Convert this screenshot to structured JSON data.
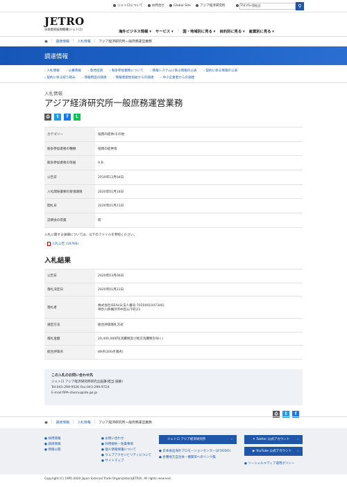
{
  "util": {
    "links": [
      "ジェトロについて",
      "お問合せ",
      "Global Site",
      "アジア経済研究所"
    ],
    "mypage": "マイページ",
    "search_placeholder": "サイト内検索"
  },
  "logo": {
    "main": "JETRO",
    "sub": "日本貿易振興機構(ジェトロ)"
  },
  "mainnav": [
    "海外ビジネス情報",
    "サービス",
    "国・地域別に見る",
    "目的別に見る",
    "産業別に見る"
  ],
  "breadcrumb": [
    "調達情報",
    "入札情報",
    "アジア経済研究所一般庶務運営業務"
  ],
  "banner_title": "調達情報",
  "subnav": [
    "入札情報",
    "公募情報",
    "意見招請",
    "競争参加資格について",
    "情報システムに係る情報の公表",
    "契約に係る情報の公表",
    "契約に係る取り組み",
    "情報物品の調達",
    "情報者能性指紋からの調達",
    "中小企業者からの調達"
  ],
  "pre_title": "入札情報",
  "title": "アジア経済研究所一般庶務運営業務",
  "share_icons": [
    "print-icon",
    "twitter-icon",
    "facebook-icon",
    "line-icon"
  ],
  "table1": [
    {
      "k": "カテゴリー",
      "v": "役務の提供/その他"
    },
    {
      "k": "競争参加資格の種類",
      "v": "役務の提供等"
    },
    {
      "k": "競争参加資格の等級",
      "v": "A,B"
    },
    {
      "k": "公告日",
      "v": "2019年12月04日"
    },
    {
      "k": "入札関係書類の受領期限",
      "v": "2020年01月14日"
    },
    {
      "k": "開札日",
      "v": "2020年01月21日"
    },
    {
      "k": "説明会の有無",
      "v": "有"
    }
  ],
  "note": "入札に関する詳細については、以下のファイルを参照ください。",
  "file_link": "入札公告 (187KB)",
  "section2_title": "入札結果",
  "table2": [
    {
      "k": "公告日",
      "v": "2020年03月06日"
    },
    {
      "k": "落札決定日",
      "v": "2020年01月21日"
    },
    {
      "k": "落札者",
      "v": "株式会社ISEALS(法人番号:7020001047346)",
      "v2": "神奈川県横浜市中区山下町23"
    },
    {
      "k": "選定方法",
      "v": "総合評価落札方式"
    },
    {
      "k": "落札金額",
      "v": "29,400,000円(消費税及び地方消費税を除く)"
    },
    {
      "k": "総合評価点",
      "v": "89点(200点満点)"
    }
  ],
  "contact": {
    "heading": "この入札のお問い合わせ先",
    "lines": [
      "ジェトロ アジア経済研究所研究企画課(担当:濱藤)",
      "Tel:043-299-9526 Fax:043-299-9724",
      "E-mail:RPA-shomu@ide.go.jp"
    ]
  },
  "footer": {
    "col1": [
      "採用情報",
      "調達情報",
      "情報公開"
    ],
    "col2": [
      "お問い合わせ",
      "利用規約・免責事項",
      "個人情報保護について",
      "ウェブアクセシビリティについて",
      "サイトマップ"
    ],
    "btn_ide": "ジェトロ アジア経済研究所",
    "ide_links": [
      "日本食品海外プロモーションセンター(JFOODO)",
      "各種地方自治体・機関等へのリンク集"
    ],
    "btn_twitter": "Twitter 公式アカウント",
    "btn_youtube": "YouTube 公式アカウント",
    "social_policy": "ソーシャルメディア運用ポリシー"
  },
  "copyright": "Copyright (C) 1995-2020 Japan External Trade Organization(JETRO). All rights reserved."
}
